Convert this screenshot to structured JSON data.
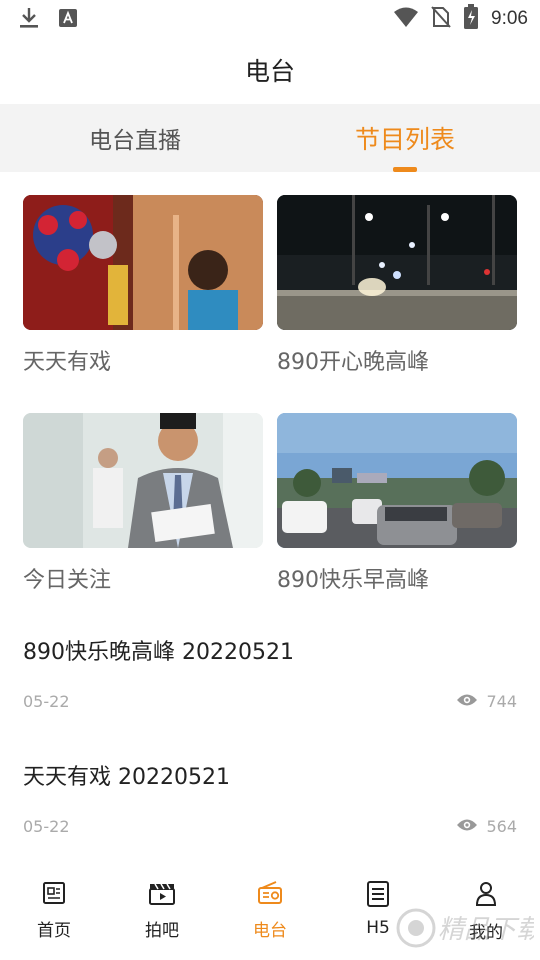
{
  "status_bar": {
    "time": "9:06",
    "left_icons": [
      "download-icon",
      "a-icon"
    ],
    "right_icons": [
      "wifi-icon",
      "no-sim-icon",
      "battery-charging-icon"
    ]
  },
  "header": {
    "title": "电台"
  },
  "tabs": [
    {
      "label": "电台直播",
      "active": false
    },
    {
      "label": "节目列表",
      "active": true
    }
  ],
  "programs": [
    {
      "title": "天天有戏",
      "image": "opera-mask-photo"
    },
    {
      "title": "890开心晚高峰",
      "image": "night-road-photo"
    },
    {
      "title": "今日关注",
      "image": "businessman-photo"
    },
    {
      "title": "890快乐早高峰",
      "image": "traffic-street-photo"
    }
  ],
  "episodes": [
    {
      "title": "890快乐晚高峰 20220521",
      "date": "05-22",
      "views": "744"
    },
    {
      "title": "天天有戏 20220521",
      "date": "05-22",
      "views": "564"
    }
  ],
  "bottom_nav": [
    {
      "label": "首页",
      "icon": "news-icon",
      "active": false
    },
    {
      "label": "拍吧",
      "icon": "clapperboard-icon",
      "active": false
    },
    {
      "label": "电台",
      "icon": "radio-icon",
      "active": true
    },
    {
      "label": "H5",
      "icon": "document-icon",
      "active": false
    },
    {
      "label": "我的",
      "icon": "person-icon",
      "active": false
    }
  ],
  "watermark": {
    "text": "精品下载"
  },
  "colors": {
    "accent": "#ee8a1c",
    "tab_bg": "#f3f3f3",
    "muted": "#aaaaaa"
  }
}
